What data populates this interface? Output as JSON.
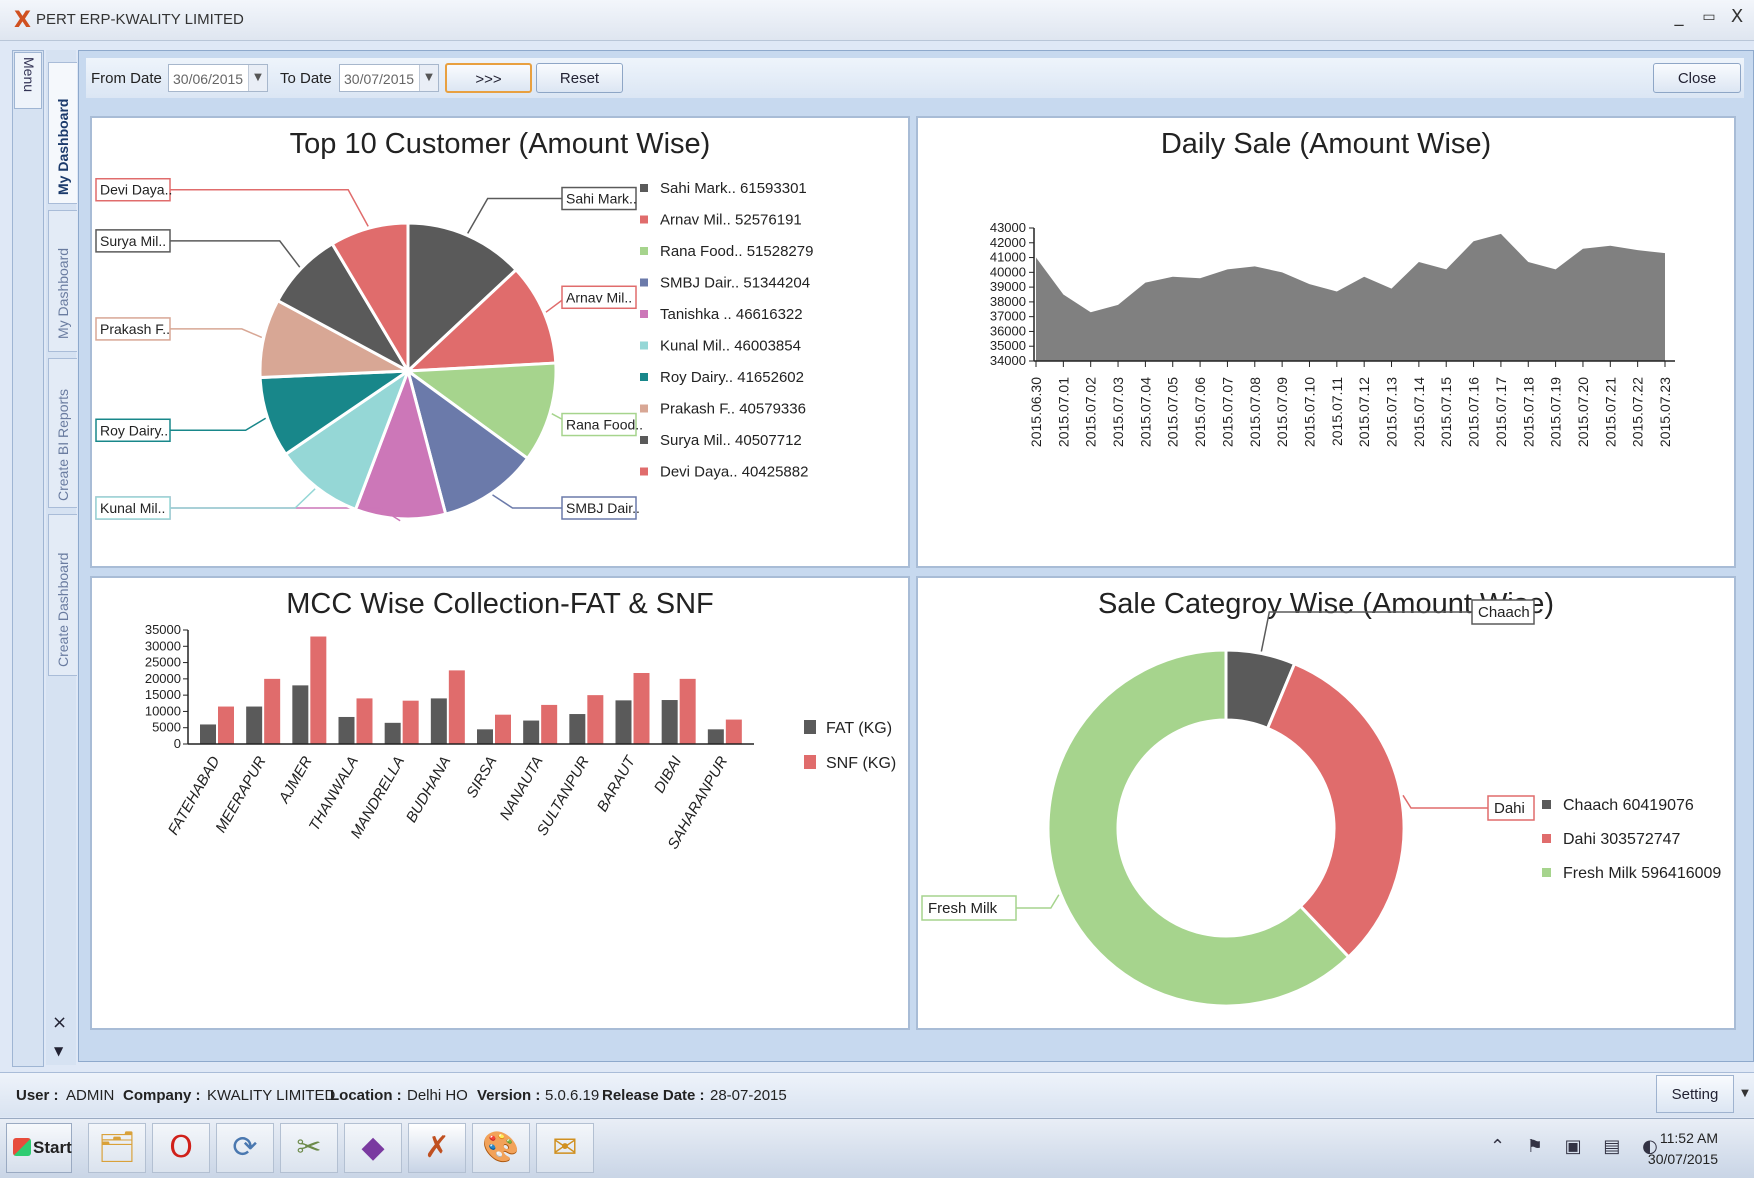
{
  "window": {
    "title": "PERT ERP-KWALITY LIMITED",
    "minimize": "_",
    "restore": "▭",
    "close": "X"
  },
  "sidebar": {
    "menu_label": "Menu",
    "tabs": [
      "My Dashboard",
      "My Dashboard",
      "Create BI Reports",
      "Create Dashboard"
    ],
    "close": "×",
    "arrow": "▼"
  },
  "toolbar": {
    "from_label": "From Date",
    "from_value": "30/06/2015",
    "to_label": "To Date",
    "to_value": "30/07/2015",
    "go_label": ">>>",
    "reset_label": "Reset",
    "close_label": "Close"
  },
  "colors": {
    "dark": "#5a5a5a",
    "red": "#e06c6c",
    "green": "#a6d48d",
    "blue": "#6b7aaa",
    "pink": "#cc77b8",
    "cyan": "#95d7d6",
    "teal": "#18878a",
    "peach": "#d8a795"
  },
  "charts": {
    "top10": {
      "title": "Top 10 Customer (Amount Wise)"
    },
    "daily": {
      "title": "Daily Sale (Amount Wise)"
    },
    "mcc": {
      "title": "MCC Wise Collection-FAT & SNF"
    },
    "category": {
      "title": "Sale Categroy Wise (Amount Wise)"
    }
  },
  "chart_data": [
    {
      "type": "pie",
      "title": "Top 10 Customer (Amount Wise)",
      "slices": [
        {
          "label": "Sahi Mark..",
          "value": 61593301,
          "color": "#5a5a5a"
        },
        {
          "label": "Arnav Mil..",
          "value": 52576191,
          "color": "#e06c6c"
        },
        {
          "label": "Rana Food..",
          "value": 51528279,
          "color": "#a6d48d"
        },
        {
          "label": "SMBJ Dair..",
          "value": 51344204,
          "color": "#6b7aaa"
        },
        {
          "label": "Tanishka ..",
          "value": 46616322,
          "color": "#cc77b8"
        },
        {
          "label": "Kunal Mil..",
          "value": 46003854,
          "color": "#95d7d6"
        },
        {
          "label": "Roy Dairy..",
          "value": 41652602,
          "color": "#18878a"
        },
        {
          "label": "Prakash F..",
          "value": 40579336,
          "color": "#d8a795"
        },
        {
          "label": "Surya Mil..",
          "value": 40507712,
          "color": "#5a5a5a"
        },
        {
          "label": "Devi Daya..",
          "value": 40425882,
          "color": "#e06c6c"
        }
      ],
      "legend": "right"
    },
    {
      "type": "area",
      "title": "Daily Sale (Amount Wise)",
      "x": [
        "2015.06.30",
        "2015.07.01",
        "2015.07.02",
        "2015.07.03",
        "2015.07.04",
        "2015.07.05",
        "2015.07.06",
        "2015.07.07",
        "2015.07.08",
        "2015.07.09",
        "2015.07.10",
        "2015.07.11",
        "2015.07.12",
        "2015.07.13",
        "2015.07.14",
        "2015.07.15",
        "2015.07.16",
        "2015.07.17",
        "2015.07.18",
        "2015.07.19",
        "2015.07.20",
        "2015.07.21",
        "2015.07.22",
        "2015.07.23"
      ],
      "values": [
        41000,
        38500,
        37300,
        37800,
        39300,
        39700,
        39600,
        40200,
        40400,
        40000,
        39200,
        38700,
        39700,
        38900,
        40700,
        40200,
        42100,
        42600,
        40700,
        40200,
        41600,
        41800,
        41500,
        41300
      ],
      "ylim": [
        34000,
        43000
      ],
      "yticks": [
        34000,
        35000,
        36000,
        37000,
        38000,
        39000,
        40000,
        41000,
        42000,
        43000
      ],
      "color": "#808080"
    },
    {
      "type": "bar",
      "title": "MCC Wise Collection-FAT & SNF",
      "categories": [
        "FATEHABAD",
        "MEERAPUR",
        "AJMER",
        "THANWALA",
        "MANDRELLA",
        "BUDHANA",
        "SIRSA",
        "NANAUTA",
        "SULTANPUR",
        "BARAUT",
        "DIBAI",
        "SAHARANPUR"
      ],
      "series": [
        {
          "name": "FAT (KG)",
          "color": "#5a5a5a",
          "values": [
            6000,
            11500,
            18000,
            8300,
            6500,
            14000,
            4500,
            7200,
            9200,
            13400,
            13500,
            4500
          ]
        },
        {
          "name": "SNF (KG)",
          "color": "#e06c6c",
          "values": [
            11500,
            20000,
            33000,
            14000,
            13300,
            22600,
            9000,
            12000,
            15000,
            21800,
            20000,
            7500
          ]
        }
      ],
      "ylim": [
        0,
        35000
      ],
      "yticks": [
        0,
        5000,
        10000,
        15000,
        20000,
        25000,
        30000,
        35000
      ],
      "legend": "right"
    },
    {
      "type": "pie",
      "title": "Sale Categroy Wise (Amount Wise)",
      "donut": true,
      "slices": [
        {
          "label": "Chaach",
          "value": 60419076,
          "color": "#5a5a5a"
        },
        {
          "label": "Dahi",
          "value": 303572747,
          "color": "#e06c6c"
        },
        {
          "label": "Fresh Milk",
          "value": 596416009,
          "color": "#a6d48d"
        }
      ],
      "legend": "right"
    }
  ],
  "status": {
    "user_label": "User :",
    "user_value": "ADMIN",
    "company_label": "Company :",
    "company_value": "KWALITY LIMITED",
    "location_label": "Location :",
    "location_value": "Delhi HO",
    "version_label": "Version :",
    "version_value": "5.0.6.19",
    "release_label": "Release Date :",
    "release_value": "28-07-2015",
    "setting_label": "Setting"
  },
  "taskbar": {
    "start_label": "Start",
    "apps": [
      {
        "name": "explorer-icon",
        "glyph": "🗂"
      },
      {
        "name": "opera-icon",
        "glyph": "O"
      },
      {
        "name": "refresh-tool-icon",
        "glyph": "⟳"
      },
      {
        "name": "tools-icon",
        "glyph": "✂"
      },
      {
        "name": "visual-studio-icon",
        "glyph": "◆"
      },
      {
        "name": "pert-erp-icon",
        "glyph": "✗"
      },
      {
        "name": "paint-icon",
        "glyph": "🎨"
      },
      {
        "name": "outlook-icon",
        "glyph": "✉"
      }
    ],
    "tray": "⌃ ⚑ ▣ ▤ ◐",
    "time": "11:52 AM",
    "date": "30/07/2015"
  }
}
